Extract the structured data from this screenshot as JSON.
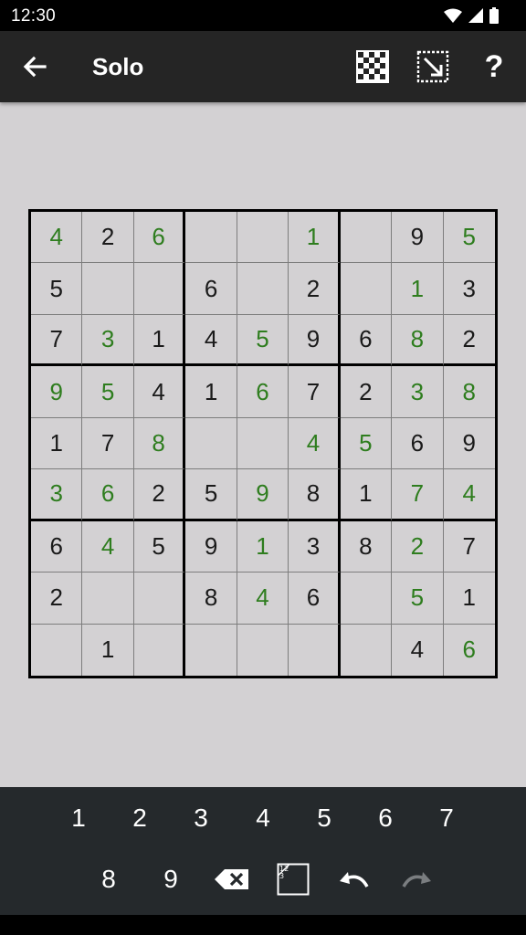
{
  "status": {
    "time": "12:30"
  },
  "appbar": {
    "title": "Solo",
    "actions": [
      {
        "name": "pattern-icon",
        "label": ""
      },
      {
        "name": "resize-icon",
        "label": ""
      },
      {
        "name": "help-icon",
        "label": "?"
      }
    ]
  },
  "board": {
    "rows": [
      [
        {
          "v": "4",
          "u": true
        },
        {
          "v": "2",
          "u": false
        },
        {
          "v": "6",
          "u": true
        },
        {
          "v": "",
          "u": false
        },
        {
          "v": "",
          "u": false
        },
        {
          "v": "1",
          "u": true
        },
        {
          "v": "",
          "u": false
        },
        {
          "v": "9",
          "u": false
        },
        {
          "v": "5",
          "u": true
        }
      ],
      [
        {
          "v": "5",
          "u": false
        },
        {
          "v": "",
          "u": false
        },
        {
          "v": "",
          "u": false
        },
        {
          "v": "6",
          "u": false
        },
        {
          "v": "",
          "u": false
        },
        {
          "v": "2",
          "u": false
        },
        {
          "v": "",
          "u": false
        },
        {
          "v": "1",
          "u": true
        },
        {
          "v": "3",
          "u": false
        }
      ],
      [
        {
          "v": "7",
          "u": false
        },
        {
          "v": "3",
          "u": true
        },
        {
          "v": "1",
          "u": false
        },
        {
          "v": "4",
          "u": false
        },
        {
          "v": "5",
          "u": true
        },
        {
          "v": "9",
          "u": false
        },
        {
          "v": "6",
          "u": false
        },
        {
          "v": "8",
          "u": true
        },
        {
          "v": "2",
          "u": false
        }
      ],
      [
        {
          "v": "9",
          "u": true
        },
        {
          "v": "5",
          "u": true
        },
        {
          "v": "4",
          "u": false
        },
        {
          "v": "1",
          "u": false
        },
        {
          "v": "6",
          "u": true
        },
        {
          "v": "7",
          "u": false
        },
        {
          "v": "2",
          "u": false
        },
        {
          "v": "3",
          "u": true
        },
        {
          "v": "8",
          "u": true
        }
      ],
      [
        {
          "v": "1",
          "u": false
        },
        {
          "v": "7",
          "u": false
        },
        {
          "v": "8",
          "u": true
        },
        {
          "v": "",
          "u": false
        },
        {
          "v": "",
          "u": false
        },
        {
          "v": "4",
          "u": true
        },
        {
          "v": "5",
          "u": true
        },
        {
          "v": "6",
          "u": false
        },
        {
          "v": "9",
          "u": false
        }
      ],
      [
        {
          "v": "3",
          "u": true
        },
        {
          "v": "6",
          "u": true
        },
        {
          "v": "2",
          "u": false
        },
        {
          "v": "5",
          "u": false
        },
        {
          "v": "9",
          "u": true
        },
        {
          "v": "8",
          "u": false
        },
        {
          "v": "1",
          "u": false
        },
        {
          "v": "7",
          "u": true
        },
        {
          "v": "4",
          "u": true
        }
      ],
      [
        {
          "v": "6",
          "u": false
        },
        {
          "v": "4",
          "u": true
        },
        {
          "v": "5",
          "u": false
        },
        {
          "v": "9",
          "u": false
        },
        {
          "v": "1",
          "u": true
        },
        {
          "v": "3",
          "u": false
        },
        {
          "v": "8",
          "u": false
        },
        {
          "v": "2",
          "u": true
        },
        {
          "v": "7",
          "u": false
        }
      ],
      [
        {
          "v": "2",
          "u": false
        },
        {
          "v": "",
          "u": false
        },
        {
          "v": "",
          "u": false
        },
        {
          "v": "8",
          "u": false
        },
        {
          "v": "4",
          "u": true
        },
        {
          "v": "6",
          "u": false
        },
        {
          "v": "",
          "u": false
        },
        {
          "v": "5",
          "u": true
        },
        {
          "v": "1",
          "u": false
        }
      ],
      [
        {
          "v": "",
          "u": false
        },
        {
          "v": "1",
          "u": false
        },
        {
          "v": "",
          "u": false
        },
        {
          "v": "",
          "u": false
        },
        {
          "v": "",
          "u": false
        },
        {
          "v": "",
          "u": false
        },
        {
          "v": "",
          "u": false
        },
        {
          "v": "4",
          "u": false
        },
        {
          "v": "6",
          "u": true
        }
      ]
    ]
  },
  "keypad": {
    "digits": [
      "1",
      "2",
      "3",
      "4",
      "5",
      "6",
      "7",
      "8",
      "9"
    ],
    "tools": [
      "backspace-icon",
      "notes-icon",
      "undo-icon",
      "redo-icon"
    ]
  },
  "colors": {
    "user_digit": "#2e7d1e",
    "given_digit": "#1a1a1a",
    "board_bg": "#d3d1d3",
    "keypad_bg": "#25292c",
    "appbar_bg": "#252525"
  }
}
